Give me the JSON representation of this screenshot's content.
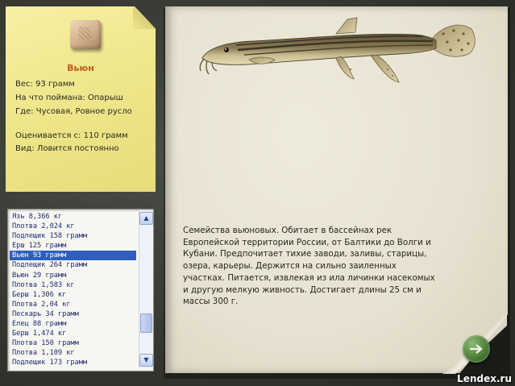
{
  "fish_card": {
    "title": "Вьюн",
    "weight": "Вес: 93 грамм",
    "bait": "На что поймана: Опарыш",
    "location": "Где: Чусовая, Ровное русло",
    "valued_from": "Оценивается с: 110 грамм",
    "type": "Вид: Ловится постоянно"
  },
  "catch_list": {
    "items": [
      "Язь 8,366 кг",
      "Плотва 2,024 кг",
      "Подлещик 158 грамм",
      "Ерш 125 грамм",
      "Вьюн 93 грамм",
      "Подлещик 264 грамм",
      "Вьюн 29 грамм",
      "Плотва 1,583 кг",
      "Берш 1,306 кг",
      "Плотва 2,04 кг",
      "Пескарь 34 грамм",
      "Елец 88 грамм",
      "Берш 1,474 кг",
      "Плотва 150 грамм",
      "Плотва 1,109 кг",
      "Подлещик 173 грамм"
    ],
    "selected_index": 4
  },
  "description": "Семейства вьюновых. Обитает в бассейнах рек Европейской территории России, от Балтики до Волги и Кубани. Предпочитает тихие заводи, заливы, старицы, озера, карьеры. Держится на сильно заиленных участках. Питается, извлекая из ила личинки насекомых и другую мелкую живность. Достигает длины 25 см и массы 300 г.",
  "watermark": "Lendex.ru",
  "icons": {
    "next": "arrow-right-icon",
    "scroll_up": "chevron-up-icon",
    "scroll_down": "chevron-down-icon"
  }
}
